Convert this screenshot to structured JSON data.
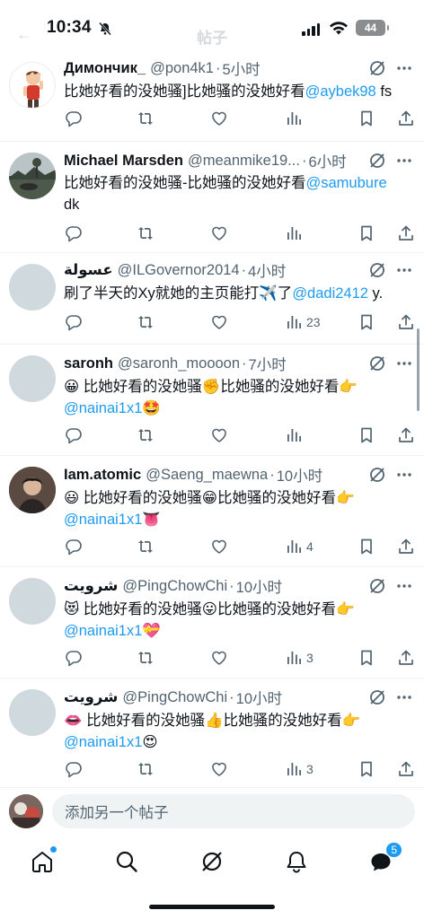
{
  "status_bar": {
    "time": "10:34",
    "battery": "44",
    "ghost_title": "帖子"
  },
  "posts": [
    {
      "name": "Димончик_",
      "handle": "@pon4k1",
      "time": "5小时",
      "text_before": "比她好看的没她骚]比她骚的没她好看",
      "mention": "@aybek98",
      "text_after": " fs",
      "line2": "",
      "views": "",
      "avatar": "cartoon"
    },
    {
      "name": "Michael Marsden",
      "handle": "@meanmike19...",
      "time": "6小时",
      "text_before": "比她好看的没她骚-比她骚的没她好看",
      "mention": "@samubure",
      "text_after": "",
      "line2": "dk",
      "views": "",
      "avatar": "photo-landscape"
    },
    {
      "name": "عسولة",
      "handle": "@ILGovernor2014",
      "time": "4小时",
      "text_before": "刷了半天的Xy就她的主页能打✈️了",
      "mention": "@dadi2412",
      "text_after": " y.",
      "line2": "",
      "views": "23",
      "avatar": "default"
    },
    {
      "name": "saronh",
      "handle": "@saronh_moooon",
      "time": "7小时",
      "text_before": "😀 比她好看的没她骚✊比她骚的没她好看👉",
      "mention": "",
      "text_after": "",
      "line2_mention": "@nainai1x1",
      "line2_emoji": "🤩",
      "views": "",
      "avatar": "default"
    },
    {
      "name": "Iam.atomic",
      "handle": "@Saeng_maewna",
      "time": "10小时",
      "text_before": "😃 比她好看的没她骚😁比她骚的没她好看👉",
      "mention": "",
      "text_after": "",
      "line2_mention": "@nainai1x1",
      "line2_emoji": "👅",
      "views": "4",
      "avatar": "photo-person"
    },
    {
      "name": "شرويت",
      "handle": "@PingChowChi",
      "time": "10小时",
      "text_before": "😻 比她好看的没她骚😛比她骚的没她好看👉",
      "mention": "",
      "text_after": "",
      "line2_mention": "@nainai1x1",
      "line2_emoji": "💝",
      "views": "3",
      "avatar": "default"
    },
    {
      "name": "شرويت",
      "handle": "@PingChowChi",
      "time": "10小时",
      "text_before": "👄 比她好看的没她骚👍比她骚的没她好看👉",
      "mention": "",
      "text_after": "",
      "line2_mention": "@nainai1x1",
      "line2_emoji": "😍",
      "views": "3",
      "avatar": "default"
    }
  ],
  "reply_bar": {
    "placeholder": "添加另一个帖子"
  },
  "tabbar": {
    "messages_badge": "5"
  },
  "colors": {
    "accent": "#1d9bf0",
    "text": "#0f1419",
    "secondary": "#536471",
    "avatar_placeholder": "#cfd9de"
  }
}
